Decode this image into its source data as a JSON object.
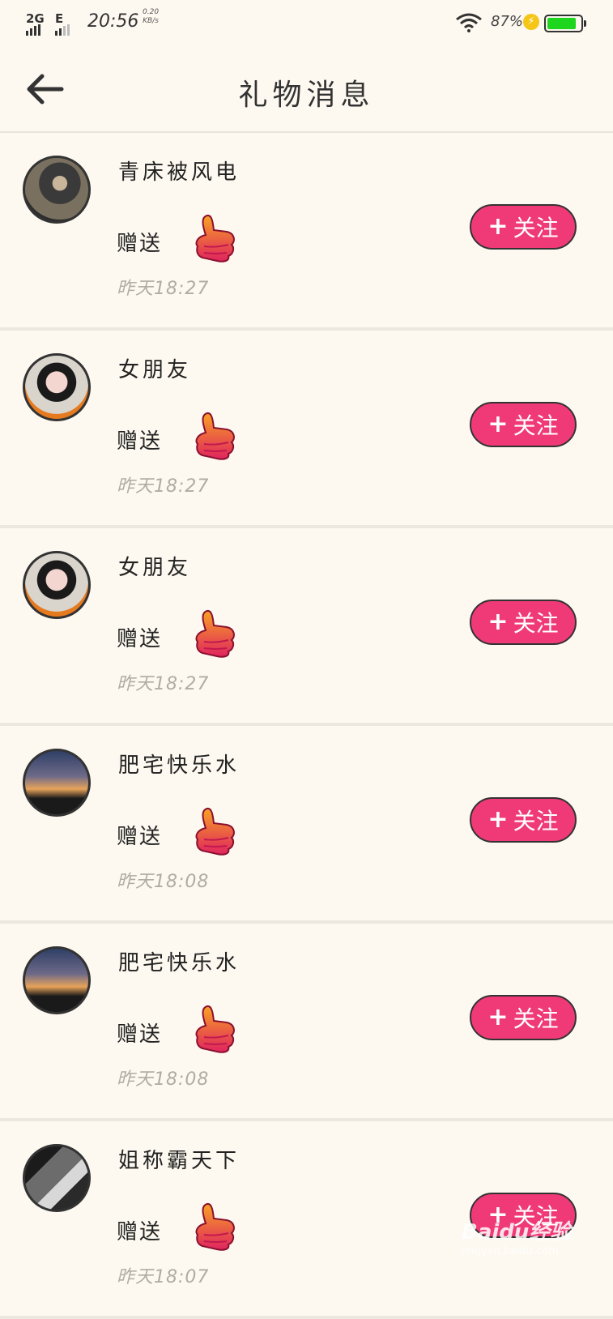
{
  "status_bar": {
    "network1": "2G",
    "network2": "E",
    "time": "20:56",
    "speed_value": "0.20",
    "speed_unit": "KB/s",
    "battery_percent": "87%",
    "battery_level": 0.87
  },
  "header": {
    "title": "礼物消息"
  },
  "follow_label": "关注",
  "follow_plus": "+",
  "accent_color": "#f03a78",
  "items": [
    {
      "name": "青床被风电",
      "action": "赠送",
      "time": "昨天18:27",
      "avatar": "a1"
    },
    {
      "name": "女朋友",
      "action": "赠送",
      "time": "昨天18:27",
      "avatar": "a2"
    },
    {
      "name": "女朋友",
      "action": "赠送",
      "time": "昨天18:27",
      "avatar": "a2"
    },
    {
      "name": "肥宅快乐水",
      "action": "赠送",
      "time": "昨天18:08",
      "avatar": "a3"
    },
    {
      "name": "肥宅快乐水",
      "action": "赠送",
      "time": "昨天18:08",
      "avatar": "a3"
    },
    {
      "name": "姐称霸天下",
      "action": "赠送",
      "time": "昨天18:07",
      "avatar": "a4"
    }
  ],
  "watermark": {
    "brand": "Baidu经验",
    "url": "jingyan.baidu.com"
  }
}
